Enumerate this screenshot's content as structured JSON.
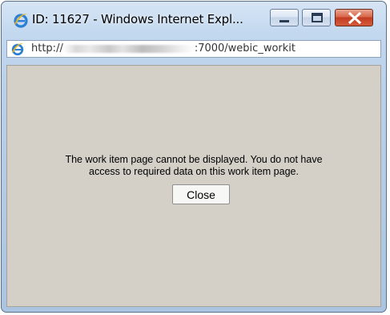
{
  "window": {
    "title": "ID: 11627 - Windows Internet Expl...",
    "minimize_icon": "minimize-icon",
    "maximize_icon": "maximize-icon",
    "close_icon": "close-icon",
    "app_icon": "internet-explorer-icon"
  },
  "address": {
    "prefix": "http://",
    "suffix": ":7000/webic_workit"
  },
  "page": {
    "message_line1": "The work item page cannot be displayed. You do not have",
    "message_line2": "access to required data on this work item page.",
    "close_label": "Close"
  },
  "colors": {
    "content_background": "#d4d0c8",
    "close_control": "#c84a2c",
    "frame": "#b9d0ea"
  }
}
